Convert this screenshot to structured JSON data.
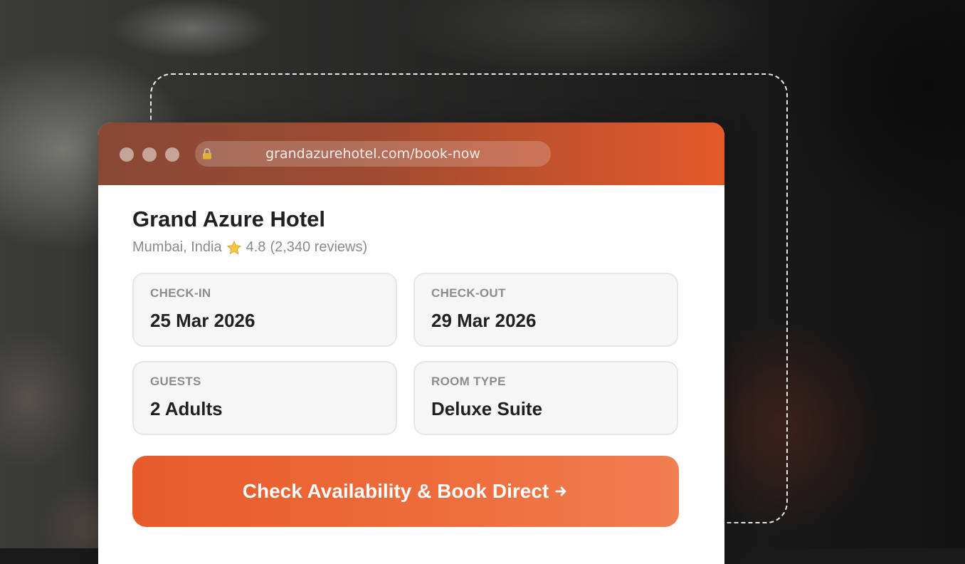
{
  "browser": {
    "url": "grandazurehotel.com/book-now",
    "lock_icon": "lock-icon"
  },
  "hotel": {
    "name": "Grand Azure Hotel",
    "location": "Mumbai, India",
    "rating": "4.8",
    "reviews": "(2,340 reviews)",
    "star_icon": "star-icon"
  },
  "booking": {
    "check_in": {
      "label": "CHECK-IN",
      "value": "25 Mar 2026"
    },
    "check_out": {
      "label": "CHECK-OUT",
      "value": "29 Mar 2026"
    },
    "guests": {
      "label": "GUESTS",
      "value": "2 Adults"
    },
    "room_type": {
      "label": "ROOM TYPE",
      "value": "Deluxe Suite"
    }
  },
  "cta": {
    "label": "Check Availability & Book Direct",
    "icon": "arrow-right-icon"
  },
  "colors": {
    "accent": "#e85a2a",
    "titlebar_start": "#874836",
    "titlebar_end": "#e4592a",
    "text_dark": "#1f1f24",
    "text_muted": "#8a8a8e"
  }
}
